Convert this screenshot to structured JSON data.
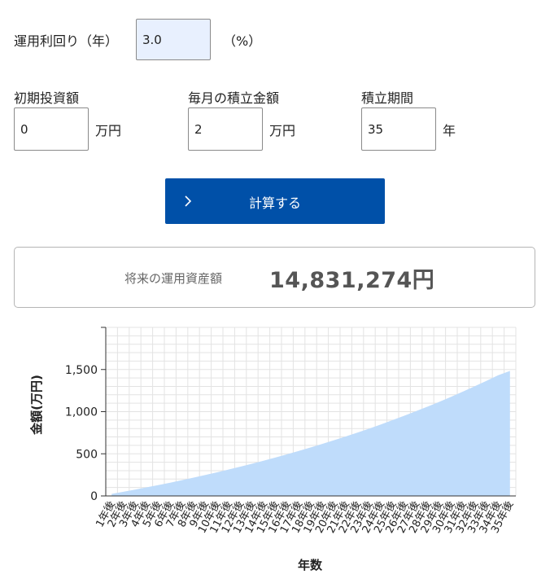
{
  "form": {
    "rate": {
      "label": "運用利回り（年）",
      "value": "3.0",
      "unit": "（%）"
    },
    "initial": {
      "label": "初期投資額",
      "value": "0",
      "unit": "万円"
    },
    "monthly": {
      "label": "毎月の積立金額",
      "value": "2",
      "unit": "万円"
    },
    "period": {
      "label": "積立期間",
      "value": "35",
      "unit": "年"
    }
  },
  "calculate_button": {
    "label": "計算する",
    "icon": "chevron-right-icon"
  },
  "result": {
    "label": "将来の運用資産額",
    "value": "14,831,274円"
  },
  "colors": {
    "accent": "#0050a8",
    "area_fill": "#bfdcfb",
    "active_input": "#e8f0fe"
  },
  "chart_data": {
    "type": "area",
    "xlabel": "年数",
    "ylabel": "金額(万円)",
    "ylim": [
      0,
      2000
    ],
    "yticks": [
      0,
      500,
      1000,
      1500
    ],
    "ytick_labels": [
      "0",
      "500",
      "1,000",
      "1,500"
    ],
    "grid": true,
    "categories": [
      "1年後",
      "2年後",
      "3年後",
      "4年後",
      "5年後",
      "6年後",
      "7年後",
      "8年後",
      "9年後",
      "10年後",
      "11年後",
      "12年後",
      "13年後",
      "14年後",
      "15年後",
      "16年後",
      "17年後",
      "18年後",
      "19年後",
      "20年後",
      "21年後",
      "22年後",
      "23年後",
      "24年後",
      "25年後",
      "26年後",
      "27年後",
      "28年後",
      "29年後",
      "30年後",
      "31年後",
      "32年後",
      "33年後",
      "34年後",
      "35年後"
    ],
    "values": [
      24.3,
      49.4,
      75.3,
      102.0,
      129.5,
      157.9,
      187.2,
      217.4,
      248.5,
      280.6,
      313.7,
      347.8,
      383.0,
      419.3,
      456.6,
      495.2,
      534.9,
      575.9,
      618.1,
      661.6,
      706.5,
      752.7,
      800.4,
      849.6,
      900.3,
      952.5,
      1006.4,
      1061.9,
      1119.1,
      1178.1,
      1239.0,
      1301.7,
      1366.4,
      1433.1,
      1483.1
    ]
  }
}
